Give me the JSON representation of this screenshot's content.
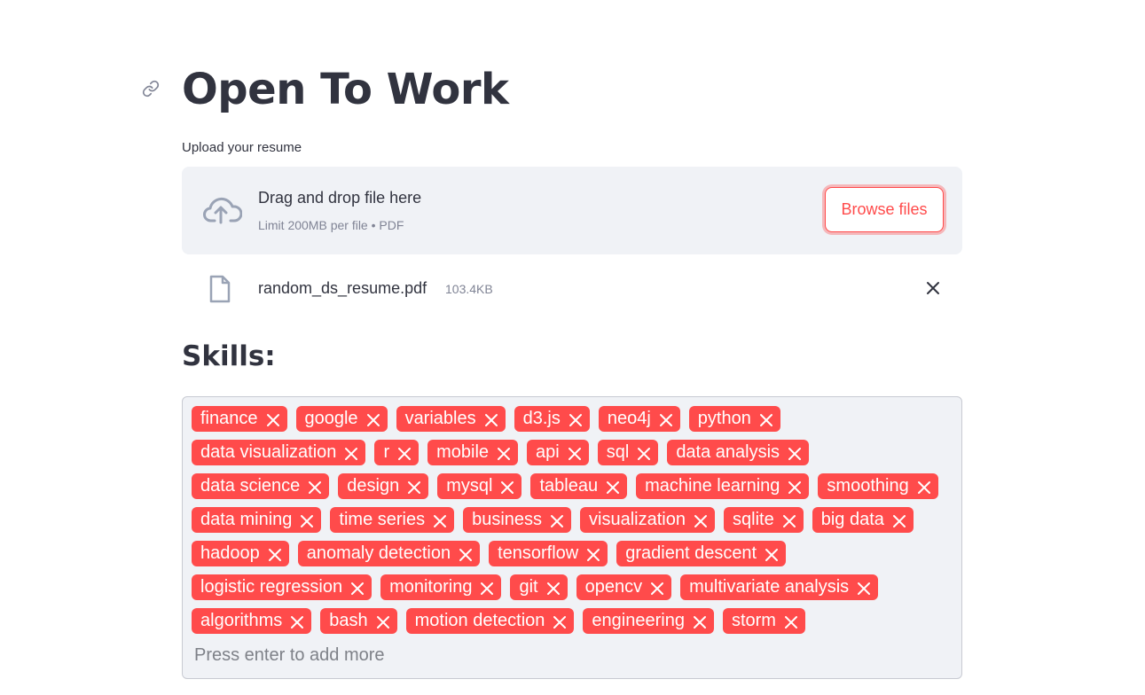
{
  "page": {
    "title": "Open To Work"
  },
  "uploader": {
    "label": "Upload your resume",
    "drop_text": "Drag and drop file here",
    "limit_text": "Limit 200MB per file • PDF",
    "browse_label": "Browse files"
  },
  "uploaded_file": {
    "name": "random_ds_resume.pdf",
    "size": "103.4KB"
  },
  "skills": {
    "heading": "Skills:",
    "input_placeholder": "Press enter to add more",
    "tags": [
      "finance",
      "google",
      "variables",
      "d3.js",
      "neo4j",
      "python",
      "data visualization",
      "r",
      "mobile",
      "api",
      "sql",
      "data analysis",
      "data science",
      "design",
      "mysql",
      "tableau",
      "machine learning",
      "smoothing",
      "data mining",
      "time series",
      "business",
      "visualization",
      "sqlite",
      "big data",
      "hadoop",
      "anomaly detection",
      "tensorflow",
      "gradient descent",
      "logistic regression",
      "monitoring",
      "git",
      "opencv",
      "multivariate analysis",
      "algorithms",
      "bash",
      "motion detection",
      "engineering",
      "storm"
    ]
  },
  "colors": {
    "accent": "#ff4b4b",
    "panel_bg": "#f0f2f6",
    "text": "#31333f",
    "muted": "#808495"
  },
  "icons": {
    "anchor": "link-icon",
    "upload": "cloud-upload-icon",
    "file": "file-icon",
    "remove": "close-icon"
  }
}
